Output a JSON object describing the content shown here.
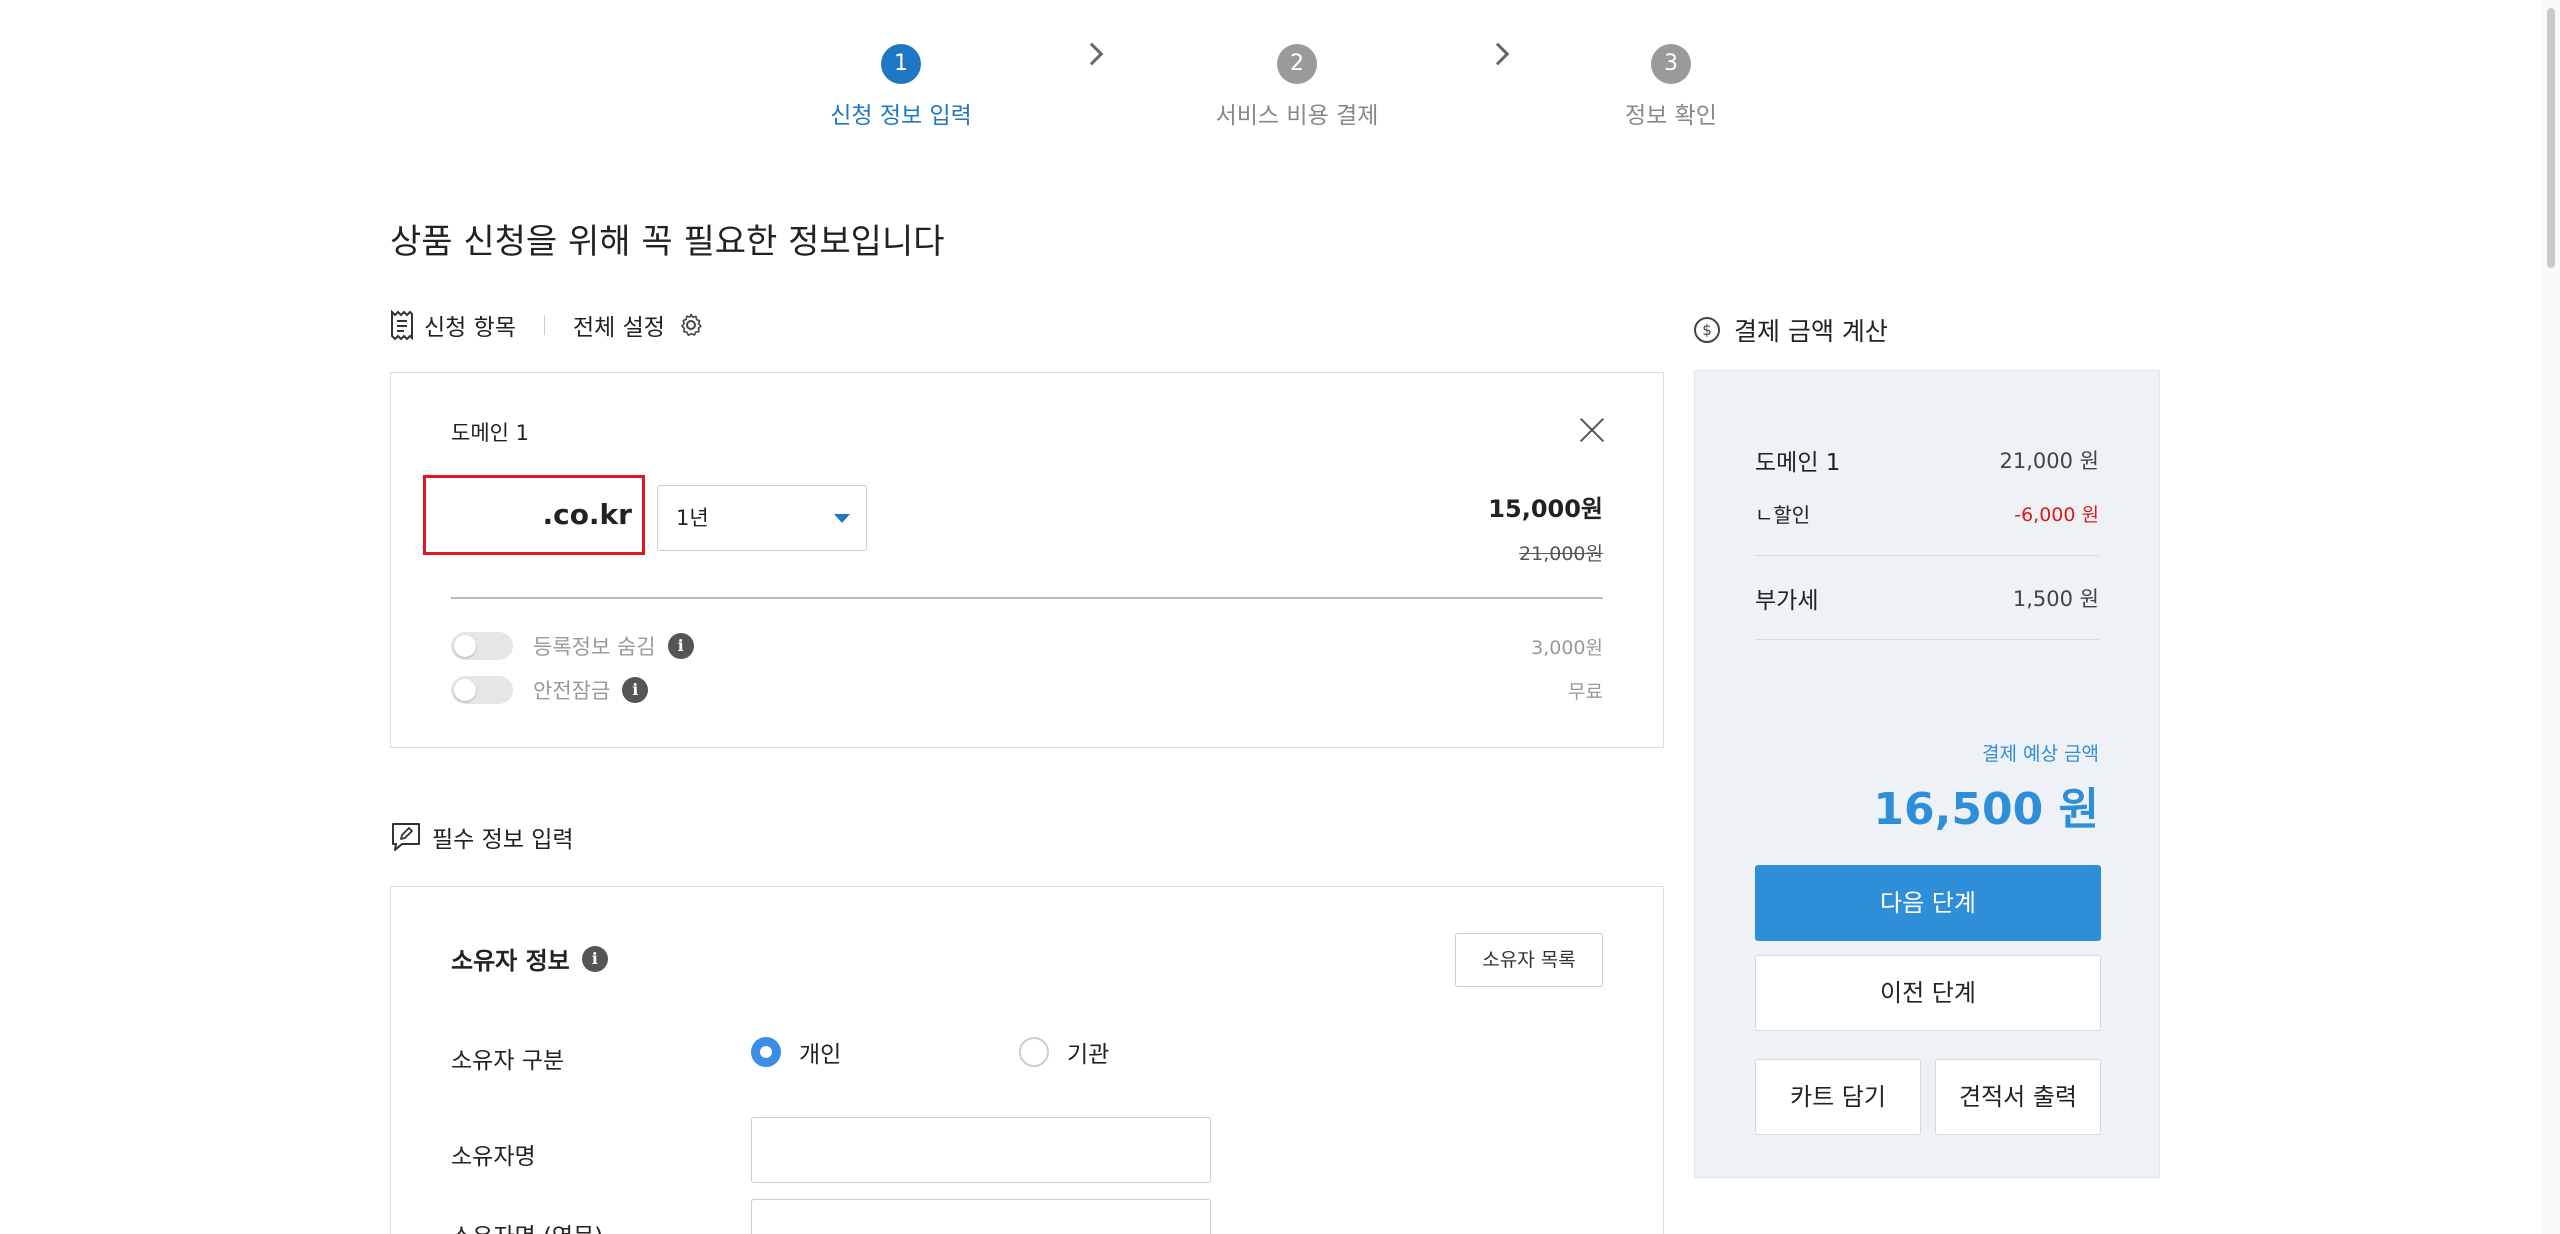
{
  "stepper": {
    "steps": [
      {
        "num": "1",
        "label": "신청 정보 입력"
      },
      {
        "num": "2",
        "label": "서비스 비용 결제"
      },
      {
        "num": "3",
        "label": "정보 확인"
      }
    ]
  },
  "page_title": "상품 신청을 위해 꼭 필요한 정보입니다",
  "items_section": {
    "label": "신청 항목",
    "settings_label": "전체 설정"
  },
  "domain_card": {
    "title": "도메인 1",
    "domain_value": ".co.kr",
    "period_value": "1년",
    "price_now": "15,000원",
    "price_old": "21,000원",
    "options": [
      {
        "label": "등록정보 숨김",
        "price": "3,000원"
      },
      {
        "label": "안전잠금",
        "price": "무료"
      }
    ]
  },
  "required_section": {
    "label": "필수 정보 입력",
    "owner_title": "소유자 정보",
    "owner_list_button": "소유자 목록",
    "owner_type_label": "소유자 구분",
    "owner_type_options": [
      "개인",
      "기관"
    ],
    "owner_type_selected": "개인",
    "owner_name_label": "소유자명",
    "owner_name_en_label": "소유자명 (영문)"
  },
  "payment": {
    "title": "결제 금액 계산",
    "rows": [
      {
        "key": "도메인 1",
        "value": "21,000 원"
      },
      {
        "key": "ㄴ할인",
        "value": "-6,000 원"
      },
      {
        "key": "부가세",
        "value": "1,500 원"
      }
    ],
    "estimate_label": "결제 예상 금액",
    "estimate_total": "16,500 원",
    "buttons": {
      "next": "다음 단계",
      "prev": "이전 단계",
      "cart": "카트 담기",
      "quote": "견적서 출력"
    }
  },
  "colors": {
    "primary": "#2e8fd8",
    "step_active": "#1f77c4",
    "discount": "#e2161d",
    "highlight_border": "#e2161d"
  }
}
